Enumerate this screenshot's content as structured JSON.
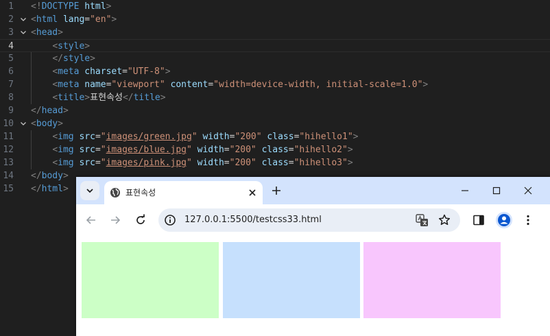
{
  "editor": {
    "lines": [
      {
        "num": "1",
        "fold": "",
        "tokens": [
          [
            "punc",
            "<!"
          ],
          [
            "tag",
            "DOCTYPE"
          ],
          [
            "punc",
            " "
          ],
          [
            "attr",
            "html"
          ],
          [
            "punc",
            ">"
          ]
        ]
      },
      {
        "num": "2",
        "fold": "v",
        "tokens": [
          [
            "punc",
            "<"
          ],
          [
            "tag",
            "html"
          ],
          [
            "text",
            " "
          ],
          [
            "attr",
            "lang"
          ],
          [
            "text",
            "="
          ],
          [
            "str",
            "\"en\""
          ],
          [
            "punc",
            ">"
          ]
        ]
      },
      {
        "num": "3",
        "fold": "v",
        "tokens": [
          [
            "punc",
            "<"
          ],
          [
            "tag",
            "head"
          ],
          [
            "punc",
            ">"
          ]
        ]
      },
      {
        "num": "4",
        "fold": "",
        "active": true,
        "tokens": [
          [
            "text",
            "    "
          ],
          [
            "punc",
            "<"
          ],
          [
            "tag",
            "style"
          ],
          [
            "punc",
            ">"
          ]
        ]
      },
      {
        "num": "5",
        "fold": "",
        "tokens": [
          [
            "text",
            "    "
          ],
          [
            "punc",
            "</"
          ],
          [
            "tag",
            "style"
          ],
          [
            "punc",
            ">"
          ]
        ]
      },
      {
        "num": "6",
        "fold": "",
        "tokens": [
          [
            "text",
            "    "
          ],
          [
            "punc",
            "<"
          ],
          [
            "tag",
            "meta"
          ],
          [
            "text",
            " "
          ],
          [
            "attr",
            "charset"
          ],
          [
            "text",
            "="
          ],
          [
            "str",
            "\"UTF-8\""
          ],
          [
            "punc",
            ">"
          ]
        ]
      },
      {
        "num": "7",
        "fold": "",
        "tokens": [
          [
            "text",
            "    "
          ],
          [
            "punc",
            "<"
          ],
          [
            "tag",
            "meta"
          ],
          [
            "text",
            " "
          ],
          [
            "attr",
            "name"
          ],
          [
            "text",
            "="
          ],
          [
            "str",
            "\"viewport\""
          ],
          [
            "text",
            " "
          ],
          [
            "attr",
            "content"
          ],
          [
            "text",
            "="
          ],
          [
            "str",
            "\"width=device-width, initial-scale=1.0\""
          ],
          [
            "punc",
            ">"
          ]
        ]
      },
      {
        "num": "8",
        "fold": "",
        "tokens": [
          [
            "text",
            "    "
          ],
          [
            "punc",
            "<"
          ],
          [
            "tag",
            "title"
          ],
          [
            "punc",
            ">"
          ],
          [
            "text",
            "표현속성"
          ],
          [
            "punc",
            "</"
          ],
          [
            "tag",
            "title"
          ],
          [
            "punc",
            ">"
          ]
        ]
      },
      {
        "num": "9",
        "fold": "",
        "tokens": [
          [
            "punc",
            "</"
          ],
          [
            "tag",
            "head"
          ],
          [
            "punc",
            ">"
          ]
        ]
      },
      {
        "num": "10",
        "fold": "v",
        "tokens": [
          [
            "punc",
            "<"
          ],
          [
            "tag",
            "body"
          ],
          [
            "punc",
            ">"
          ]
        ]
      },
      {
        "num": "11",
        "fold": "",
        "tokens": [
          [
            "text",
            "    "
          ],
          [
            "punc",
            "<"
          ],
          [
            "tag",
            "img"
          ],
          [
            "text",
            " "
          ],
          [
            "attr",
            "src"
          ],
          [
            "text",
            "="
          ],
          [
            "str",
            "\""
          ],
          [
            "link",
            "images/green.jpg"
          ],
          [
            "str",
            "\""
          ],
          [
            "text",
            " "
          ],
          [
            "attr",
            "width"
          ],
          [
            "text",
            "="
          ],
          [
            "str",
            "\"200\""
          ],
          [
            "text",
            " "
          ],
          [
            "attr",
            "class"
          ],
          [
            "text",
            "="
          ],
          [
            "str",
            "\"hihello1\""
          ],
          [
            "punc",
            ">"
          ]
        ]
      },
      {
        "num": "12",
        "fold": "",
        "tokens": [
          [
            "text",
            "    "
          ],
          [
            "punc",
            "<"
          ],
          [
            "tag",
            "img"
          ],
          [
            "text",
            " "
          ],
          [
            "attr",
            "src"
          ],
          [
            "text",
            "="
          ],
          [
            "str",
            "\""
          ],
          [
            "link",
            "images/blue.jpg"
          ],
          [
            "str",
            "\""
          ],
          [
            "text",
            " "
          ],
          [
            "attr",
            "width"
          ],
          [
            "text",
            "="
          ],
          [
            "str",
            "\"200\""
          ],
          [
            "text",
            " "
          ],
          [
            "attr",
            "class"
          ],
          [
            "text",
            "="
          ],
          [
            "str",
            "\"hihello2\""
          ],
          [
            "punc",
            ">"
          ]
        ]
      },
      {
        "num": "13",
        "fold": "",
        "tokens": [
          [
            "text",
            "    "
          ],
          [
            "punc",
            "<"
          ],
          [
            "tag",
            "img"
          ],
          [
            "text",
            " "
          ],
          [
            "attr",
            "src"
          ],
          [
            "text",
            "="
          ],
          [
            "str",
            "\""
          ],
          [
            "link",
            "images/pink.jpg"
          ],
          [
            "str",
            "\""
          ],
          [
            "text",
            " "
          ],
          [
            "attr",
            "width"
          ],
          [
            "text",
            "="
          ],
          [
            "str",
            "\"200\""
          ],
          [
            "text",
            " "
          ],
          [
            "attr",
            "class"
          ],
          [
            "text",
            "="
          ],
          [
            "str",
            "\"hihello3\""
          ],
          [
            "punc",
            ">"
          ]
        ]
      },
      {
        "num": "14",
        "fold": "",
        "tokens": [
          [
            "punc",
            "</"
          ],
          [
            "tag",
            "body"
          ],
          [
            "punc",
            ">"
          ]
        ]
      },
      {
        "num": "15",
        "fold": "",
        "tokens": [
          [
            "punc",
            "</"
          ],
          [
            "tag",
            "html"
          ],
          [
            "punc",
            ">"
          ]
        ]
      }
    ]
  },
  "browser": {
    "tab_title": "표현속성",
    "url": "127.0.0.1:5500/testcss33.html",
    "images": [
      {
        "name": "green-image",
        "color": "#ccffc6"
      },
      {
        "name": "blue-image",
        "color": "#c6e0fd"
      },
      {
        "name": "pink-image",
        "color": "#f8c6fd"
      }
    ]
  }
}
